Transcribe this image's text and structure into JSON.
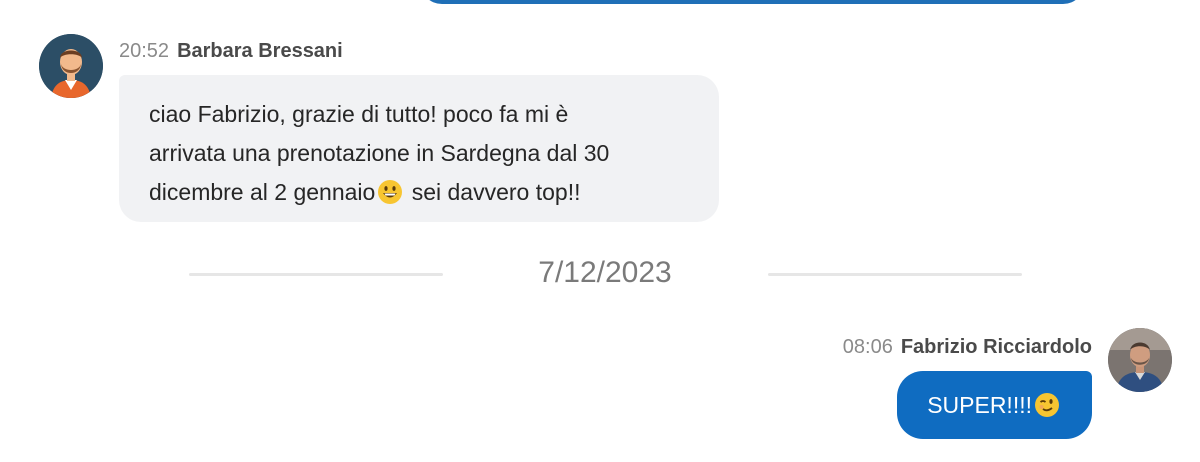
{
  "colors": {
    "accent": "#0f6cc1",
    "incoming_bubble": "#f1f2f4",
    "divider": "#e6e6e6"
  },
  "messages": [
    {
      "time": "20:52",
      "sender": "Barbara Bressani",
      "avatar_icon": "avatar-illustration-icon",
      "lines": [
        "ciao Fabrizio, grazie di tutto! poco fa mi è",
        "arrivata una prenotazione in Sardegna dal 30",
        "dicembre al 2 gennaio",
        " sei davvero top!!"
      ],
      "emoji": "grinning-face-emoji"
    },
    {
      "time": "08:06",
      "sender": "Fabrizio Ricciardolo",
      "avatar_icon": "avatar-photo-icon",
      "text": "SUPER!!!! ",
      "emoji": "winking-face-emoji"
    }
  ],
  "date_divider": "7/12/2023"
}
